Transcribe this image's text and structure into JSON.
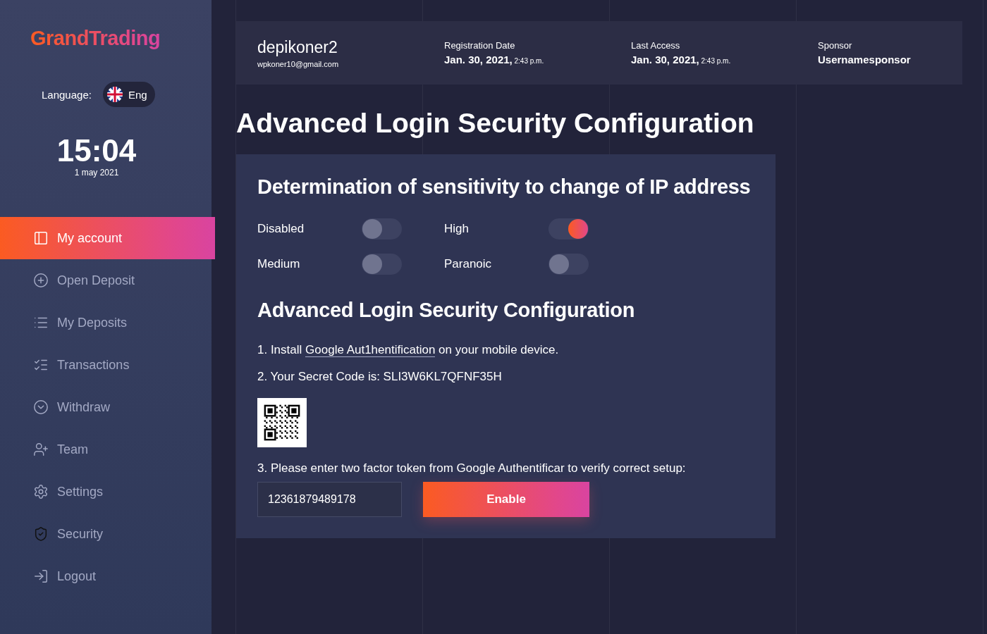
{
  "brand": "GrandTrading",
  "language": {
    "label": "Language:",
    "value": "Eng"
  },
  "clock": {
    "time": "15:04",
    "date": "1 may 2021"
  },
  "nav": [
    {
      "label": "My account",
      "selected": true
    },
    {
      "label": "Open Deposit",
      "selected": false
    },
    {
      "label": "My Deposits",
      "selected": false
    },
    {
      "label": "Transactions",
      "selected": false
    },
    {
      "label": "Withdraw",
      "selected": false
    },
    {
      "label": "Team",
      "selected": false
    },
    {
      "label": "Settings",
      "selected": false
    },
    {
      "label": "Security",
      "selected": false
    },
    {
      "label": "Logout",
      "selected": false
    }
  ],
  "user": {
    "name": "depikoner2",
    "email": "wpkoner10@gmail.com"
  },
  "info": [
    {
      "label": "Registration Date",
      "value": "Jan. 30, 2021,",
      "time": "2:43 p.m."
    },
    {
      "label": "Last Access",
      "value": "Jan. 30, 2021,",
      "time": "2:43 p.m."
    },
    {
      "label": "Sponsor",
      "value": "Usernamesponsor"
    }
  ],
  "page_title": "Advanced Login Security Configuration",
  "card": {
    "title": "Determination of sensitivity to change of IP address",
    "options": [
      {
        "label": "Disabled",
        "on": false
      },
      {
        "label": "High",
        "on": true
      },
      {
        "label": "Medium",
        "on": false
      },
      {
        "label": "Paranoic",
        "on": false
      }
    ],
    "subtitle": "Advanced Login Security Configuration",
    "step1": {
      "before": "1. Install ",
      "link": "Google Aut1hentification",
      "after": " on your mobile device."
    },
    "step2": "2. Your Secret Code is: SLI3W6KL7QFNF35H",
    "step3": "3. Please enter two factor token from Google Authentificar to verify correct setup:",
    "token": "12361879489178",
    "button": "Enable"
  }
}
